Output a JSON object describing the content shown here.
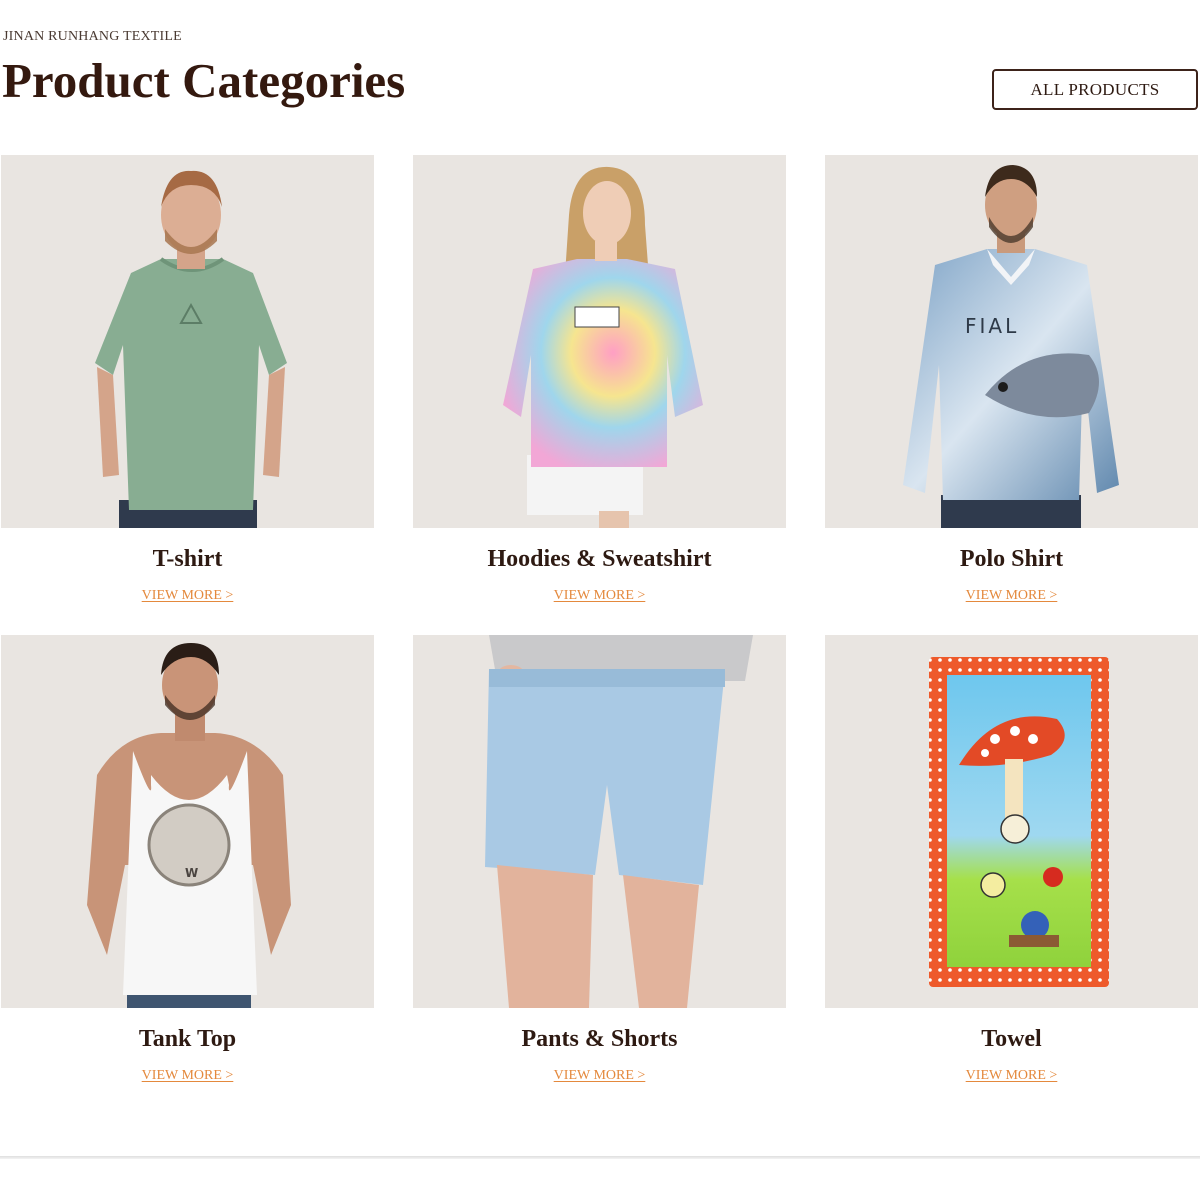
{
  "header": {
    "eyebrow": "JINAN RUNHANG TEXTILE",
    "title": "Product Categories",
    "all_products_label": "ALL PRODUCTS"
  },
  "categories": [
    {
      "name": "T-shirt",
      "link_label": "VIEW MORE >",
      "image": "man-in-green-tshirt"
    },
    {
      "name": "Hoodies & Sweatshirt",
      "link_label": "VIEW MORE >",
      "image": "woman-in-tie-dye-sweatshirt"
    },
    {
      "name": "Polo Shirt",
      "link_label": "VIEW MORE >",
      "image": "man-in-fish-print-polo",
      "image_text": "FIAL"
    },
    {
      "name": "Tank Top",
      "link_label": "VIEW MORE >",
      "image": "man-in-white-tank-top",
      "image_text": "W"
    },
    {
      "name": "Pants & Shorts",
      "link_label": "VIEW MORE >",
      "image": "blue-sweat-shorts"
    },
    {
      "name": "Towel",
      "link_label": "VIEW MORE >",
      "image": "mushroom-cartoon-towel"
    }
  ],
  "colors": {
    "heading": "#34190f",
    "link": "#e4893d",
    "card_bg": "#e9e5e1",
    "button_border": "#3d231a"
  }
}
